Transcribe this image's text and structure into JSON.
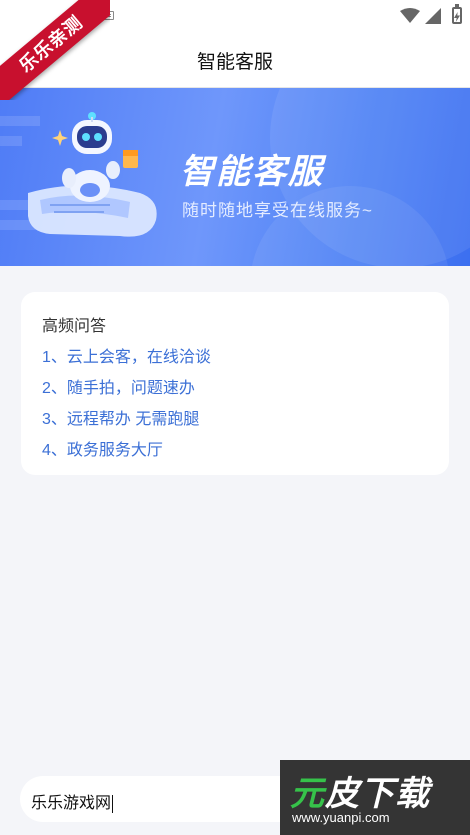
{
  "watermark_corner": {
    "label": "乐乐亲测"
  },
  "nav": {
    "title": "智能客服"
  },
  "banner": {
    "title": "智能客服",
    "subtitle": "随时随地享受在线服务~"
  },
  "faq": {
    "title": "高频问答",
    "items": [
      {
        "label": "1、云上会客，在线洽谈"
      },
      {
        "label": "2、随手拍，问题速办"
      },
      {
        "label": "3、远程帮办 无需跑腿"
      },
      {
        "label": "4、政务服务大厅"
      }
    ]
  },
  "chat_input": {
    "value": "乐乐游戏网"
  },
  "site_watermark": {
    "logo_a": "元",
    "logo_b": "皮下载",
    "url": "www.yuanpi.com"
  },
  "colors": {
    "accent": "#3c70d6",
    "banner_start": "#4f7cf6",
    "ribbon": "#c8102e"
  }
}
